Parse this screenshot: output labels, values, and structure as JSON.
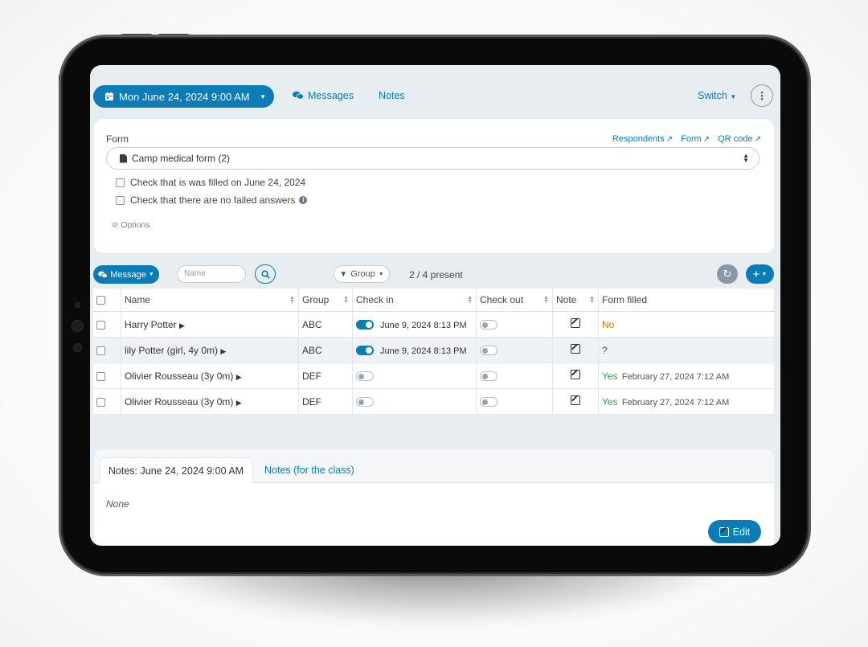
{
  "header": {
    "date_button": "Mon June 24, 2024 9:00 AM",
    "messages_link": "Messages",
    "notes_link": "Notes",
    "switch_link": "Switch"
  },
  "form_card": {
    "label": "Form",
    "links": {
      "respondents": "Respondents",
      "form": "Form",
      "qr_code": "QR code"
    },
    "selected_form": "Camp medical form (2)",
    "checks": [
      {
        "label": "Check that is was filled on June 24, 2024",
        "checked": false
      },
      {
        "label": "Check that there are no failed answers",
        "checked": false
      }
    ],
    "options_label": "Options"
  },
  "toolbar": {
    "message_button": "Message",
    "name_placeholder": "Name",
    "group_button": "Group",
    "present_count": "2 / 4 present"
  },
  "table": {
    "columns": [
      "Name",
      "Group",
      "Check in",
      "Check out",
      "Note",
      "Form filled"
    ],
    "rows": [
      {
        "name": "Harry Potter",
        "group": "ABC",
        "checkin_on": true,
        "checkin_time": "June 9, 2024 8:13 PM",
        "checkout_on": false,
        "form_status": "No",
        "form_date": ""
      },
      {
        "name": "lily Potter (girl, 4y 0m)",
        "group": "ABC",
        "checkin_on": true,
        "checkin_time": "June 9, 2024 8:13 PM",
        "checkout_on": false,
        "form_status": "?",
        "form_date": ""
      },
      {
        "name": "Olivier Rousseau (3y 0m)",
        "group": "DEF",
        "checkin_on": false,
        "checkin_time": "",
        "checkout_on": false,
        "form_status": "Yes",
        "form_date": "February 27, 2024 7:12 AM"
      },
      {
        "name": "Olivier Rousseau (3y 0m)",
        "group": "DEF",
        "checkin_on": false,
        "checkin_time": "",
        "checkout_on": false,
        "form_status": "Yes",
        "form_date": "February 27, 2024 7:12 AM"
      }
    ]
  },
  "notes": {
    "tab_active": "Notes: June 24, 2024 9:00 AM",
    "tab_class": "Notes (for the class)",
    "content": "None",
    "edit_button": "Edit"
  },
  "colors": {
    "accent": "#0b7cb5",
    "yes": "#28a745",
    "no": "#e07b00"
  }
}
